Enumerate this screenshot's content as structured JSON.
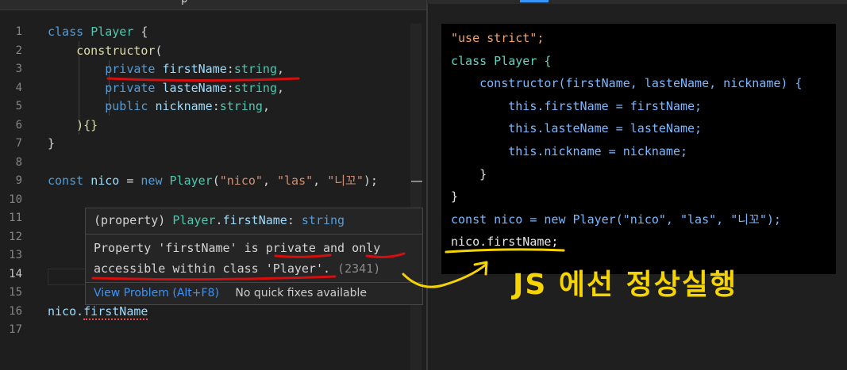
{
  "editor": {
    "tab_title": "p",
    "line_numbers": [
      "1",
      "2",
      "3",
      "4",
      "5",
      "6",
      "7",
      "8",
      "9",
      "10",
      "11",
      "12",
      "13",
      "14",
      "15",
      "16",
      "17"
    ],
    "active_line": "14",
    "code": {
      "l1": {
        "kw": "class",
        "cls": "Player",
        "rest": " {"
      },
      "l2": {
        "fn": "constructor",
        "rest": "("
      },
      "l3": {
        "kw": "private",
        "id": "firstName",
        "type": "string",
        "rest": ","
      },
      "l4": {
        "kw": "private",
        "id": "lasteName",
        "type": "string",
        "rest": ","
      },
      "l5": {
        "kw": "public",
        "id": "nickname",
        "type": "string",
        "rest": ","
      },
      "l6": {
        "rest": "){}"
      },
      "l7": {
        "rest": "}"
      },
      "l9": {
        "kw": "const",
        "id": "nico",
        "eq": " = ",
        "kw2": "new",
        "cls": "Player",
        "a1": "\"nico\"",
        "a2": "\"las\"",
        "a3": "\"니꼬\"",
        "end": ");"
      },
      "l16": {
        "obj": "nico.",
        "prop": "firstName"
      }
    },
    "hover": {
      "signature": {
        "prefix": "(property) ",
        "cls": "Player",
        "dot": ".",
        "prop": "firstName",
        "colon": ": ",
        "type": "string"
      },
      "message_line1": "Property 'firstName' is private and only",
      "message_line2_text": "accessible within class 'Player'.",
      "message_code": "(2341)",
      "view_problem": "View Problem (Alt+F8)",
      "no_fixes": "No quick fixes available"
    }
  },
  "output": {
    "lines": [
      "\"use strict\";",
      "class Player {",
      "    constructor(firstName, lasteName, nickname) {",
      "        this.firstName = firstName;",
      "        this.lasteName = lasteName;",
      "        this.nickname = nickname;",
      "    }",
      "}",
      "const nico = new Player(\"nico\", \"las\", \"니꼬\");",
      "nico.firstName;"
    ]
  },
  "annotation": {
    "text": "JS 에선 정상실행",
    "color": "#f5d400"
  },
  "colors": {
    "keyword": "#569cd6",
    "class": "#4ec9b0",
    "string": "#ce9178",
    "annotation_red": "#d40f0f",
    "annotation_yellow": "#f5d400"
  }
}
